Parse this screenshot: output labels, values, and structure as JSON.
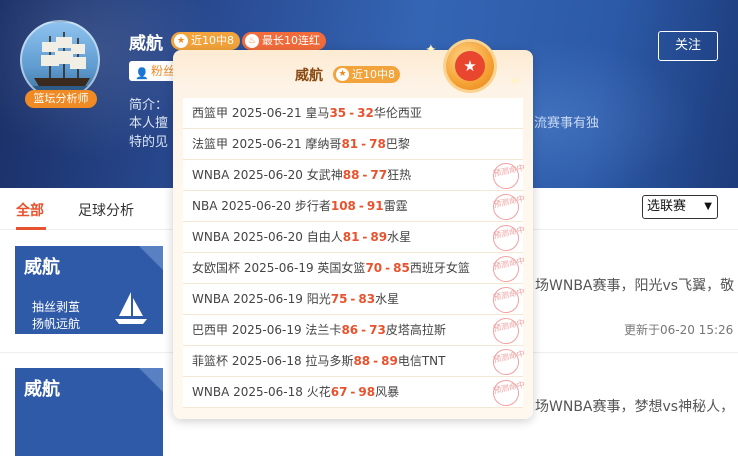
{
  "profile": {
    "name": "威航",
    "avatar_badge": "篮坛分析师",
    "tag_recent": "近10中8",
    "tag_streak": "最长10连红",
    "fans_label": "粉丝",
    "bio_label": "简介：",
    "bio_line1": "本人擅",
    "bio_line2": "特的见",
    "bio_right": "流赛事有独",
    "follow_label": "关注"
  },
  "tabs": [
    {
      "label": "全部"
    },
    {
      "label": "足球分析"
    }
  ],
  "league_select": {
    "value": "选联赛"
  },
  "articles": [
    {
      "card_title": "威航",
      "card_line1": "抽丝剥茧",
      "card_line2": "扬帆远航",
      "snippet": "场WNBA赛事，阳光vs飞翼，敬",
      "updated": "更新于06-20 15:26"
    },
    {
      "card_title": "威航",
      "snippet": "场WNBA赛事，梦想vs神秘人，"
    }
  ],
  "popup": {
    "title": "威航",
    "tag": "近10中8",
    "stamp_text": "预测命中",
    "records": [
      {
        "league": "西篮甲",
        "date": "2025-06-21",
        "home": "皇马",
        "home_score": "35",
        "away_score": "32",
        "away": "华伦西亚",
        "hit": false
      },
      {
        "league": "法篮甲",
        "date": "2025-06-21",
        "home": "摩纳哥",
        "home_score": "81",
        "away_score": "78",
        "away": "巴黎",
        "hit": false
      },
      {
        "league": "WNBA",
        "date": "2025-06-20",
        "home": "女武神",
        "home_score": "88",
        "away_score": "77",
        "away": "狂热",
        "hit": true
      },
      {
        "league": "NBA",
        "date": "2025-06-20",
        "home": "步行者",
        "home_score": "108",
        "away_score": "91",
        "away": "雷霆",
        "hit": true
      },
      {
        "league": "WNBA",
        "date": "2025-06-20",
        "home": "自由人",
        "home_score": "81",
        "away_score": "89",
        "away": "水星",
        "hit": true
      },
      {
        "league": "女欧国杯",
        "date": "2025-06-19",
        "home": "英国女篮",
        "home_score": "70",
        "away_score": "85",
        "away": "西班牙女篮",
        "hit": true
      },
      {
        "league": "WNBA",
        "date": "2025-06-19",
        "home": "阳光",
        "home_score": "75",
        "away_score": "83",
        "away": "水星",
        "hit": true
      },
      {
        "league": "巴西甲",
        "date": "2025-06-19",
        "home": "法兰卡",
        "home_score": "86",
        "away_score": "73",
        "away": "皮塔高拉斯",
        "hit": true
      },
      {
        "league": "菲篮杯",
        "date": "2025-06-18",
        "home": "拉马多斯",
        "home_score": "88",
        "away_score": "89",
        "away": "电信TNT",
        "hit": true
      },
      {
        "league": "WNBA",
        "date": "2025-06-18",
        "home": "火花",
        "home_score": "67",
        "away_score": "98",
        "away": "风暴",
        "hit": true
      }
    ]
  }
}
